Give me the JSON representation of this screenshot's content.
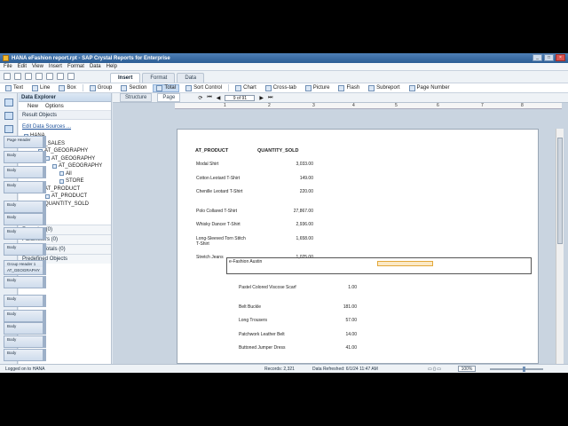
{
  "window": {
    "title": "HANA eFashion report.rpt - SAP Crystal Reports for Enterprise"
  },
  "menu": [
    "File",
    "Edit",
    "View",
    "Insert",
    "Format",
    "Data",
    "Help"
  ],
  "tabs": [
    "Insert",
    "Format",
    "Data"
  ],
  "active_tab": "Insert",
  "insert_toolbar": [
    "Text",
    "Line",
    "Box",
    "Group",
    "Section",
    "Total",
    "Sort Control",
    "Chart",
    "Cross-tab",
    "Picture",
    "Flash",
    "Subreport",
    "Page Number"
  ],
  "explorer": {
    "title": "Data Explorer",
    "new_label": "New",
    "options_label": "Options",
    "result_objects": "Result Objects",
    "edit_sources": "Edit Data Sources ...",
    "tree": [
      "HANA",
      "AN_SALES",
      "AT_GEOGRAPHY",
      "AT_GEOGRAPHY",
      "AT_GEOGRAPHY",
      "All",
      "STORE",
      "AT_PRODUCT",
      "AT_PRODUCT",
      "QUANTITY_SOLD"
    ],
    "collapsed": [
      "Formulas (0)",
      "Parameters (0)",
      "Running Totals (0)",
      "Predefined Objects"
    ]
  },
  "view": {
    "structure": "Structure",
    "page": "Page",
    "page_indicator": "9 of 91"
  },
  "ruler": [
    "1",
    "2",
    "3",
    "4",
    "5",
    "6",
    "7",
    "8"
  ],
  "bands": [
    "Page Header",
    "Body",
    "Body",
    "Body",
    "Body",
    "Body",
    "Body",
    "Body",
    "Group Header 1",
    "AT_GEOGRAPHY",
    "Body",
    "Body",
    "Body",
    "Body",
    "Body",
    "Body",
    "Body"
  ],
  "report": {
    "col1": "AT_PRODUCT",
    "col2": "QUANTITY_SOLD",
    "rows": [
      {
        "name": "Modal Shirt",
        "qty": "3,033.00"
      },
      {
        "name": "Cotton Leotard T-Shirt",
        "qty": "149.00"
      },
      {
        "name": "Chenille Leotard T-Shirt",
        "qty": "220.00"
      },
      {
        "name": "Polo Collared T-Shirt",
        "qty": "27,867.00"
      },
      {
        "name": "Whisky Dancer T-Shirt",
        "qty": "2,936.00"
      },
      {
        "name": "Long-Sleeved Torn Stitch T-Shirt",
        "qty": "1,658.00"
      },
      {
        "name": "Stretch Jeans",
        "qty": "1,025.00"
      }
    ],
    "group_label": "e-Fashion Austin",
    "rows2": [
      {
        "name": "Pastel Colored Viscose Scarf",
        "qty": "1.00"
      },
      {
        "name": "Belt Buckle",
        "qty": "181.00"
      },
      {
        "name": "Long Trousers",
        "qty": "57.00"
      },
      {
        "name": "Patchwork Leather Belt",
        "qty": "14.00"
      },
      {
        "name": "Buttoned Jumper Dress",
        "qty": "41.00"
      }
    ]
  },
  "status": {
    "logged": "Logged on to HANA",
    "records": "Records: 2,321",
    "refreshed": "Data Refreshed: 6/1/24 11:47 AM",
    "zoom": "100%"
  }
}
